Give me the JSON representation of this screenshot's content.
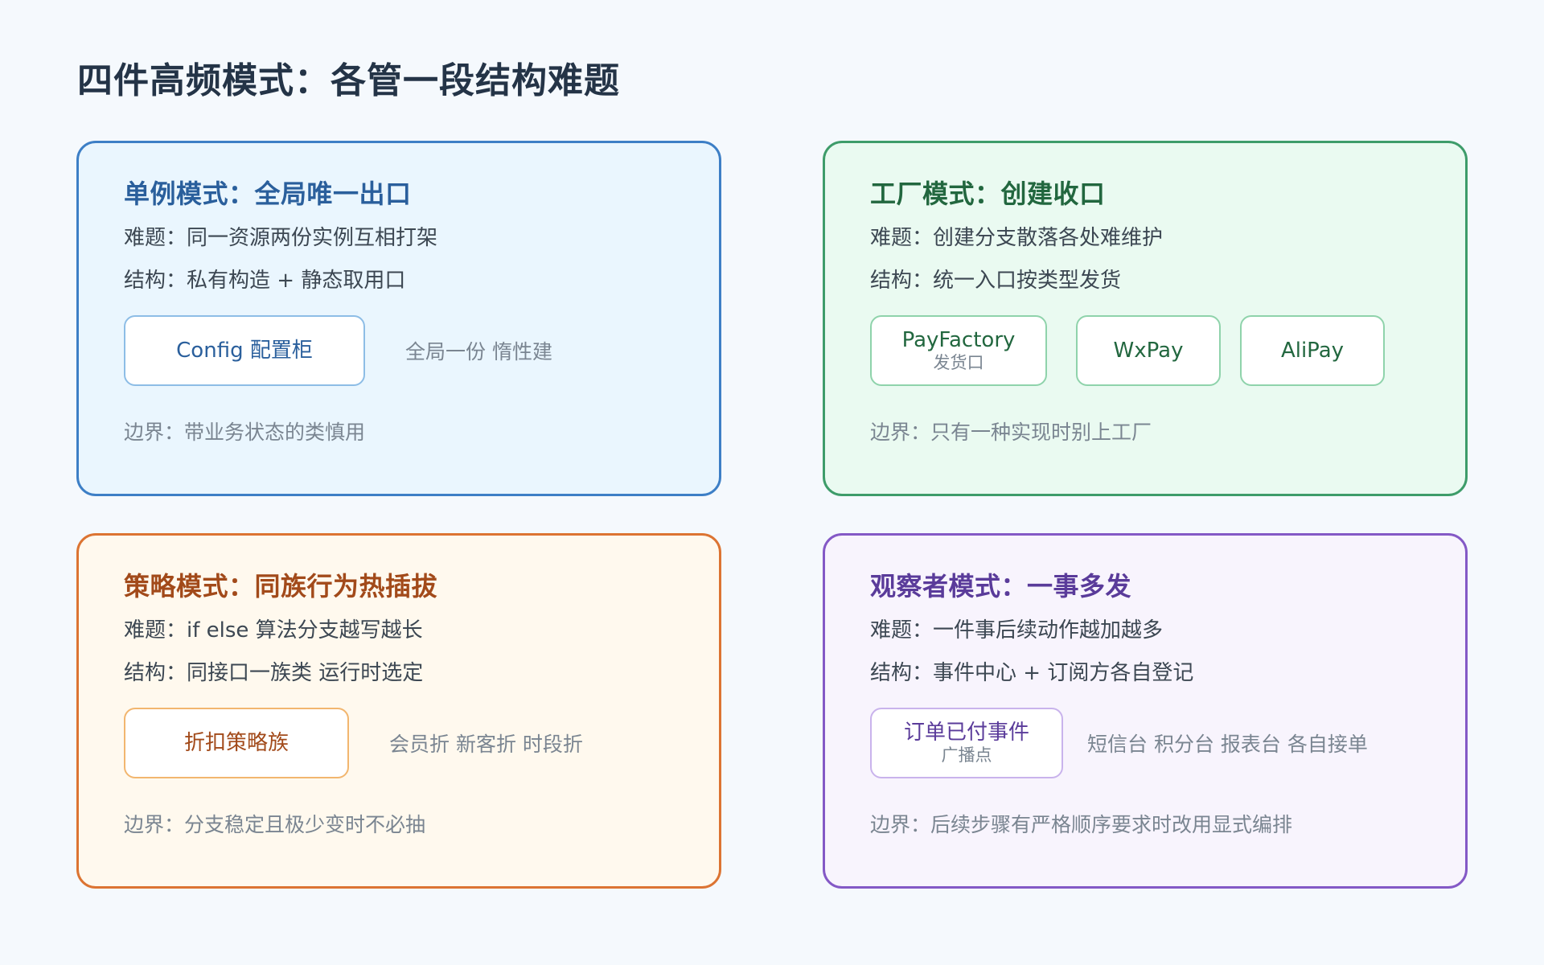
{
  "page": {
    "title": "四件高频模式：各管一段结构难题"
  },
  "cards": [
    {
      "title": "单例模式：全局唯一出口",
      "difficulty": "难题：同一资源两份实例互相打架",
      "structure": "结构：私有构造 + 静态取用口",
      "chips": [
        {
          "main": "Config 配置柜"
        }
      ],
      "note": "全局一份 惰性建",
      "boundary": "边界：带业务状态的类慎用",
      "color": "#3d7fc6"
    },
    {
      "title": "工厂模式：创建收口",
      "difficulty": "难题：创建分支散落各处难维护",
      "structure": "结构：统一入口按类型发货",
      "chips": [
        {
          "main": "PayFactory",
          "sub": "发货口"
        },
        {
          "main": "WxPay"
        },
        {
          "main": "AliPay"
        }
      ],
      "boundary": "边界：只有一种实现时别上工厂",
      "color": "#3e9c6a"
    },
    {
      "title": "策略模式：同族行为热插拔",
      "difficulty": "难题：if else 算法分支越写越长",
      "structure": "结构：同接口一族类 运行时选定",
      "chips": [
        {
          "main": "折扣策略族"
        }
      ],
      "note": "会员折 新客折 时段折",
      "boundary": "边界：分支稳定且极少变时不必抽",
      "color": "#dc7432"
    },
    {
      "title": "观察者模式：一事多发",
      "difficulty": "难题：一件事后续动作越加越多",
      "structure": "结构：事件中心 + 订阅方各自登记",
      "chips": [
        {
          "main": "订单已付事件",
          "sub": "广播点"
        }
      ],
      "note": "短信台 积分台 报表台 各自接单",
      "boundary": "边界：后续步骤有严格顺序要求时改用显式编排",
      "color": "#8459c6"
    }
  ]
}
